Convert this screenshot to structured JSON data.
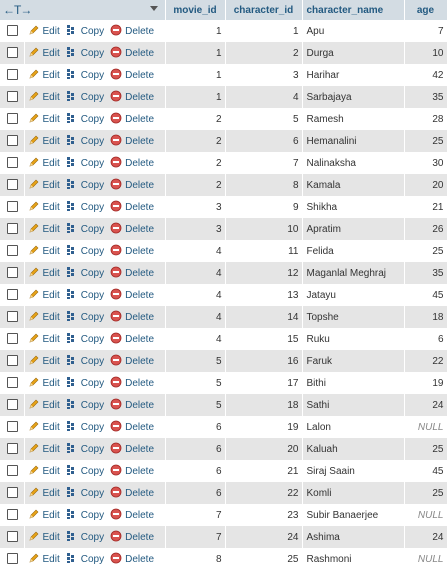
{
  "header": {
    "arrows": "←T→",
    "columns": [
      "movie_id",
      "character_id",
      "character_name",
      "age"
    ]
  },
  "actions": {
    "edit": "Edit",
    "copy": "Copy",
    "delete": "Delete"
  },
  "rows": [
    {
      "movie_id": "1",
      "character_id": "1",
      "character_name": "Apu",
      "age": "7"
    },
    {
      "movie_id": "1",
      "character_id": "2",
      "character_name": "Durga",
      "age": "10"
    },
    {
      "movie_id": "1",
      "character_id": "3",
      "character_name": "Harihar",
      "age": "42"
    },
    {
      "movie_id": "1",
      "character_id": "4",
      "character_name": "Sarbajaya",
      "age": "35"
    },
    {
      "movie_id": "2",
      "character_id": "5",
      "character_name": "Ramesh",
      "age": "28"
    },
    {
      "movie_id": "2",
      "character_id": "6",
      "character_name": "Hemanalini",
      "age": "25"
    },
    {
      "movie_id": "2",
      "character_id": "7",
      "character_name": "Nalinaksha",
      "age": "30"
    },
    {
      "movie_id": "2",
      "character_id": "8",
      "character_name": "Kamala",
      "age": "20"
    },
    {
      "movie_id": "3",
      "character_id": "9",
      "character_name": "Shikha",
      "age": "21"
    },
    {
      "movie_id": "3",
      "character_id": "10",
      "character_name": "Apratim",
      "age": "26"
    },
    {
      "movie_id": "4",
      "character_id": "11",
      "character_name": "Felida",
      "age": "25"
    },
    {
      "movie_id": "4",
      "character_id": "12",
      "character_name": "Maganlal Meghraj",
      "age": "35"
    },
    {
      "movie_id": "4",
      "character_id": "13",
      "character_name": "Jatayu",
      "age": "45"
    },
    {
      "movie_id": "4",
      "character_id": "14",
      "character_name": "Topshe",
      "age": "18"
    },
    {
      "movie_id": "4",
      "character_id": "15",
      "character_name": "Ruku",
      "age": "6"
    },
    {
      "movie_id": "5",
      "character_id": "16",
      "character_name": "Faruk",
      "age": "22"
    },
    {
      "movie_id": "5",
      "character_id": "17",
      "character_name": "Bithi",
      "age": "19"
    },
    {
      "movie_id": "5",
      "character_id": "18",
      "character_name": "Sathi",
      "age": "24"
    },
    {
      "movie_id": "6",
      "character_id": "19",
      "character_name": "Lalon",
      "age": "NULL"
    },
    {
      "movie_id": "6",
      "character_id": "20",
      "character_name": "Kaluah",
      "age": "25"
    },
    {
      "movie_id": "6",
      "character_id": "21",
      "character_name": "Siraj Saain",
      "age": "45"
    },
    {
      "movie_id": "6",
      "character_id": "22",
      "character_name": "Komli",
      "age": "25"
    },
    {
      "movie_id": "7",
      "character_id": "23",
      "character_name": "Subir Banaerjee",
      "age": "NULL"
    },
    {
      "movie_id": "7",
      "character_id": "24",
      "character_name": "Ashima",
      "age": "24"
    },
    {
      "movie_id": "8",
      "character_id": "25",
      "character_name": "Rashmoni",
      "age": "NULL"
    }
  ],
  "colors": {
    "header_bg": "#d3dce3",
    "link": "#235a81",
    "even_row": "#e5e5e5",
    "delete_icon": "#d9534f",
    "edit_icon": "#e8a317"
  }
}
